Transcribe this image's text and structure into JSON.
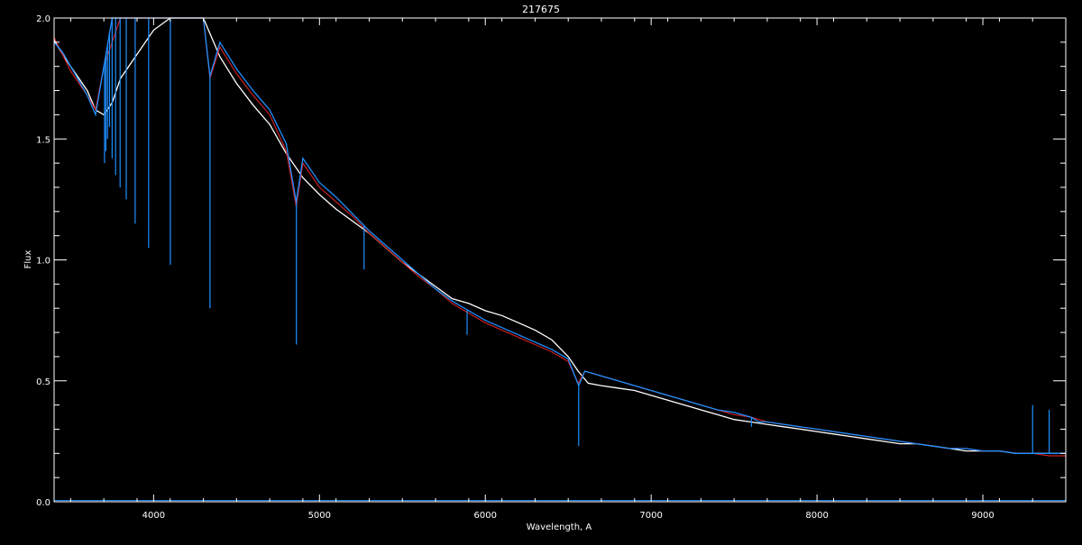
{
  "chart_data": {
    "type": "line",
    "title": "217675",
    "xlabel": "Wavelength, A",
    "ylabel": "Flux",
    "xlim": [
      3400,
      9500
    ],
    "ylim": [
      0,
      2.0
    ],
    "x_ticks": [
      4000,
      5000,
      6000,
      7000,
      8000,
      9000
    ],
    "x_tick_labels": [
      "4000",
      "5000",
      "6000",
      "7000",
      "8000",
      "9000"
    ],
    "y_ticks": [
      0.0,
      0.5,
      1.0,
      1.5,
      2.0
    ],
    "y_tick_labels": [
      "0.0",
      "0.5",
      "1.0",
      "1.5",
      "2.0"
    ],
    "grid": false,
    "series": [
      {
        "color": "#ffffff",
        "x": [
          3400,
          3450,
          3500,
          3550,
          3600,
          3650,
          3700,
          3750,
          3800,
          3900,
          4000,
          4100,
          4200,
          4300,
          4400,
          4500,
          4600,
          4700,
          4800,
          4900,
          5000,
          5100,
          5200,
          5300,
          5400,
          5500,
          5600,
          5700,
          5800,
          5900,
          6000,
          6100,
          6200,
          6300,
          6400,
          6500,
          6560,
          6620,
          6700,
          6800,
          6900,
          7000,
          7100,
          7200,
          7300,
          7400,
          7500,
          7600,
          7700,
          7800,
          7900,
          8000,
          8100,
          8200,
          8300,
          8400,
          8500,
          8600,
          8700,
          8800,
          8900,
          9000,
          9100,
          9200,
          9300,
          9400,
          9500
        ],
        "y": [
          1.91,
          1.85,
          1.8,
          1.75,
          1.7,
          1.62,
          1.6,
          1.65,
          1.75,
          1.85,
          1.95,
          2.0,
          2.0,
          2.0,
          1.84,
          1.73,
          1.64,
          1.56,
          1.44,
          1.34,
          1.27,
          1.21,
          1.16,
          1.11,
          1.05,
          0.99,
          0.94,
          0.89,
          0.84,
          0.82,
          0.79,
          0.77,
          0.74,
          0.71,
          0.67,
          0.6,
          0.54,
          0.49,
          0.48,
          0.47,
          0.46,
          0.44,
          0.42,
          0.4,
          0.38,
          0.36,
          0.34,
          0.33,
          0.32,
          0.31,
          0.3,
          0.29,
          0.28,
          0.27,
          0.26,
          0.25,
          0.24,
          0.24,
          0.23,
          0.22,
          0.21,
          0.21,
          0.21,
          0.2,
          0.2,
          0.2,
          0.2
        ]
      },
      {
        "color": "#cc1f1f",
        "x": [
          3400,
          3500,
          3600,
          3650,
          3700,
          3800,
          3900,
          4000,
          4100,
          4200,
          4300,
          4340,
          4400,
          4500,
          4600,
          4700,
          4800,
          4860,
          4900,
          5000,
          5100,
          5200,
          5300,
          5400,
          5500,
          5600,
          5700,
          5800,
          5900,
          6000,
          6100,
          6200,
          6300,
          6400,
          6500,
          6560,
          6600,
          6700,
          6800,
          6900,
          7000,
          7100,
          7200,
          7300,
          7400,
          7500,
          7600,
          7700,
          7800,
          7900,
          8000,
          8100,
          8200,
          8300,
          8400,
          8500,
          8600,
          8700,
          8800,
          8900,
          9000,
          9100,
          9200,
          9300,
          9400,
          9500
        ],
        "y": [
          1.92,
          1.78,
          1.68,
          1.62,
          1.8,
          2.0,
          2.0,
          2.0,
          2.0,
          2.0,
          2.0,
          1.75,
          1.88,
          1.77,
          1.68,
          1.6,
          1.45,
          1.22,
          1.4,
          1.3,
          1.24,
          1.18,
          1.11,
          1.05,
          0.99,
          0.93,
          0.88,
          0.82,
          0.78,
          0.74,
          0.71,
          0.68,
          0.65,
          0.62,
          0.58,
          0.49,
          0.54,
          0.52,
          0.5,
          0.48,
          0.46,
          0.44,
          0.42,
          0.4,
          0.38,
          0.36,
          0.35,
          0.33,
          0.32,
          0.31,
          0.3,
          0.29,
          0.28,
          0.27,
          0.26,
          0.25,
          0.24,
          0.23,
          0.22,
          0.22,
          0.21,
          0.21,
          0.2,
          0.2,
          0.19,
          0.19
        ]
      },
      {
        "color": "#1e90ff",
        "x": [
          3400,
          3450,
          3500,
          3550,
          3600,
          3650,
          3700,
          3750,
          3800,
          3900,
          4000,
          4100,
          4200,
          4300,
          4340,
          4400,
          4500,
          4600,
          4700,
          4800,
          4860,
          4900,
          5000,
          5100,
          5200,
          5300,
          5400,
          5500,
          5600,
          5700,
          5800,
          5900,
          6000,
          6100,
          6200,
          6300,
          6400,
          6500,
          6563,
          6600,
          6700,
          6800,
          6900,
          7000,
          7100,
          7200,
          7300,
          7400,
          7500,
          7600,
          7650,
          7700,
          7800,
          7900,
          8000,
          8100,
          8200,
          8300,
          8400,
          8500,
          8600,
          8700,
          8800,
          8900,
          9000,
          9100,
          9200,
          9300,
          9400,
          9500
        ],
        "y": [
          1.9,
          1.86,
          1.8,
          1.74,
          1.68,
          1.6,
          1.8,
          2.0,
          2.0,
          2.0,
          2.0,
          2.0,
          2.0,
          2.0,
          1.76,
          1.9,
          1.79,
          1.7,
          1.62,
          1.48,
          1.24,
          1.42,
          1.32,
          1.26,
          1.19,
          1.12,
          1.06,
          1.0,
          0.94,
          0.88,
          0.83,
          0.79,
          0.75,
          0.72,
          0.69,
          0.66,
          0.63,
          0.59,
          0.48,
          0.54,
          0.52,
          0.5,
          0.48,
          0.46,
          0.44,
          0.42,
          0.4,
          0.38,
          0.37,
          0.35,
          0.33,
          0.33,
          0.32,
          0.31,
          0.3,
          0.29,
          0.28,
          0.27,
          0.26,
          0.25,
          0.24,
          0.23,
          0.22,
          0.22,
          0.21,
          0.21,
          0.2,
          0.2,
          0.2,
          0.2
        ]
      }
    ],
    "absorption_lines": [
      {
        "x": 3704,
        "depth_to": 1.4
      },
      {
        "x": 3712,
        "depth_to": 1.45
      },
      {
        "x": 3722,
        "depth_to": 1.5
      },
      {
        "x": 3734,
        "depth_to": 1.55
      },
      {
        "x": 3750,
        "depth_to": 1.42
      },
      {
        "x": 3771,
        "depth_to": 1.35
      },
      {
        "x": 3798,
        "depth_to": 1.3
      },
      {
        "x": 3835,
        "depth_to": 1.25
      },
      {
        "x": 3889,
        "depth_to": 1.15
      },
      {
        "x": 3970,
        "depth_to": 1.05
      },
      {
        "x": 4101,
        "depth_to": 0.98
      },
      {
        "x": 4340,
        "depth_to": 0.8
      },
      {
        "x": 4861,
        "depth_to": 0.65
      },
      {
        "x": 5269,
        "depth_to": 0.96
      },
      {
        "x": 5890,
        "depth_to": 0.69
      },
      {
        "x": 6563,
        "depth_to": 0.23
      },
      {
        "x": 7605,
        "depth_to": 0.31
      },
      {
        "x": 9300,
        "depth_to": 0.4
      },
      {
        "x": 9400,
        "depth_to": 0.38
      }
    ]
  }
}
